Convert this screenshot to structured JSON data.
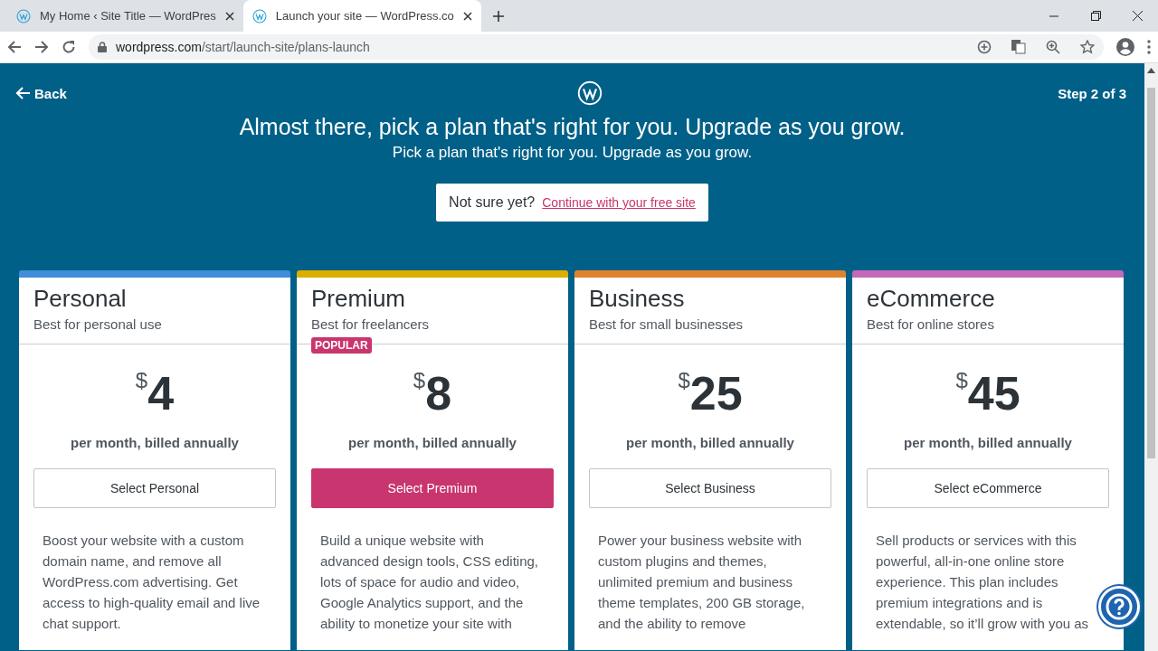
{
  "browser": {
    "tabs": [
      {
        "title": "My Home ‹ Site Title — WordPres",
        "selected": false
      },
      {
        "title": "Launch your site — WordPress.co",
        "selected": true
      }
    ],
    "url_host": "wordpress.com",
    "url_path": "/start/launch-site/plans-launch"
  },
  "page": {
    "back": "Back",
    "step": "Step 2 of 3",
    "heading": "Almost there, pick a plan that's right for you. Upgrade as you grow.",
    "subheading": "Pick a plan that's right for you. Upgrade as you grow.",
    "notice": {
      "text": "Not sure yet?",
      "link": "Continue with your free site"
    },
    "plans": [
      {
        "name": "Personal",
        "tagline": "Best for personal use",
        "currency": "$",
        "price": "4",
        "period": "per month, billed annually",
        "button": "Select Personal",
        "primary": false,
        "color": "#3e8ed8",
        "description": "Boost your website with a custom domain name, and remove all WordPress.com advertising. Get access to high-quality email and live chat support."
      },
      {
        "name": "Premium",
        "tagline": "Best for freelancers",
        "badge": "POPULAR",
        "currency": "$",
        "price": "8",
        "period": "per month, billed annually",
        "button": "Select Premium",
        "primary": true,
        "color": "#dbae00",
        "description": "Build a unique website with advanced design tools, CSS editing, lots of space for audio and video, Google Analytics support, and the ability to monetize your site with"
      },
      {
        "name": "Business",
        "tagline": "Best for small businesses",
        "currency": "$",
        "price": "25",
        "period": "per month, billed annually",
        "button": "Select Business",
        "primary": false,
        "color": "#e0832f",
        "description": "Power your business website with custom plugins and themes, unlimited premium and business theme templates, 200 GB storage, and the ability to remove"
      },
      {
        "name": "eCommerce",
        "tagline": "Best for online stores",
        "currency": "$",
        "price": "45",
        "period": "per month, billed annually",
        "button": "Select eCommerce",
        "primary": false,
        "color": "#c468b8",
        "description": "Sell products or services with this powerful, all-in-one online store experience. This plan includes premium integrations and is extendable, so it’ll grow with you as"
      }
    ]
  }
}
